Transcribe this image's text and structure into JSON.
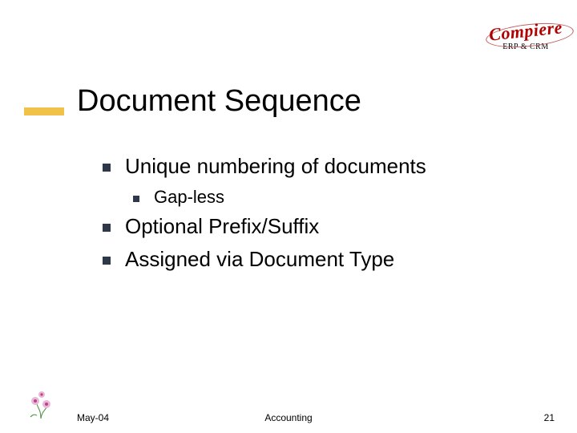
{
  "logo": {
    "brand": "Compiere",
    "tagline": "ERP & CRM"
  },
  "title": "Document Sequence",
  "bullets": [
    {
      "level": 1,
      "text": "Unique numbering of documents",
      "children": [
        {
          "level": 2,
          "text": "Gap-less"
        }
      ]
    },
    {
      "level": 1,
      "text": "Optional Prefix/Suffix"
    },
    {
      "level": 1,
      "text": "Assigned via Document Type"
    }
  ],
  "footer": {
    "date": "May-04",
    "section": "Accounting",
    "page": "21"
  }
}
